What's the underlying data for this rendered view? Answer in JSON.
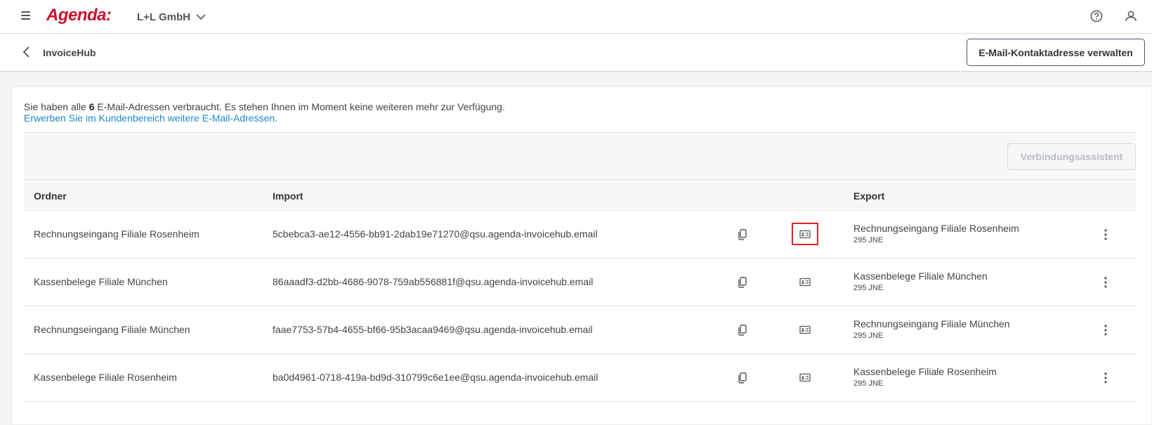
{
  "header": {
    "logo": "Agenda:",
    "company": "L+L GmbH"
  },
  "subheader": {
    "title": "InvoiceHub",
    "manage_button": "E-Mail-Kontaktadresse verwalten"
  },
  "info": {
    "text_before": "Sie haben alle ",
    "count": "6",
    "text_after": " E-Mail-Adressen verbraucht. Es stehen Ihnen im Moment keine weiteren mehr zur Verfügung.",
    "link": "Erwerben Sie im Kundenbereich weitere E-Mail-Adressen."
  },
  "toolbar": {
    "wizard_button": "Verbindungsassistent"
  },
  "table": {
    "columns": [
      "Ordner",
      "Import",
      "Export"
    ],
    "rows": [
      {
        "folder": "Rechnungseingang Filiale Rosenheim",
        "import": "5cbebca3-ae12-4556-bb91-2dab19e71270@qsu.agenda-invoicehub.email",
        "export_name": "Rechnungseingang Filiale Rosenheim",
        "export_sub": "295 JNE"
      },
      {
        "folder": "Kassenbelege Filiale München",
        "import": "86aaadf3-d2bb-4686-9078-759ab556881f@qsu.agenda-invoicehub.email",
        "export_name": "Kassenbelege Filiale München",
        "export_sub": "295 JNE"
      },
      {
        "folder": "Rechnungseingang Filiale München",
        "import": "faae7753-57b4-4655-bf66-95b3acaa9469@qsu.agenda-invoicehub.email",
        "export_name": "Rechnungseingang Filiale München",
        "export_sub": "295 JNE"
      },
      {
        "folder": "Kassenbelege Filiale Rosenheim",
        "import": "ba0d4961-0718-419a-bd9d-310799c6e1ee@qsu.agenda-invoicehub.email",
        "export_name": "Kassenbelege Filiale Rosenheim",
        "export_sub": "295 JNE"
      }
    ]
  },
  "colors": {
    "brand": "#c8102e",
    "link": "#1e88c7",
    "highlight": "#e01f26"
  },
  "icons": {
    "menu": "hamburger-menu-icon",
    "company_dropdown": "chevron-down-icon",
    "help": "help-circle-icon",
    "user": "user-icon",
    "back": "chevron-left-icon",
    "copy": "copy-icon",
    "contact_card": "contact-card-icon",
    "more": "more-vertical-icon"
  }
}
